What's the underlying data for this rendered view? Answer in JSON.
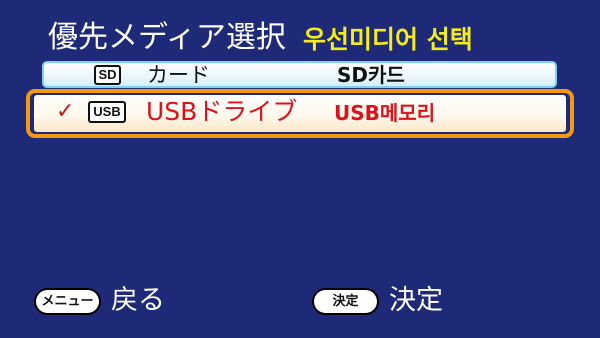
{
  "header": {
    "title_jp": "優先メディア選択",
    "title_ko": "우선미디어 선택"
  },
  "items": [
    {
      "icon": "SD",
      "label_jp": "カード",
      "label_ko": "SD카드",
      "selected": false
    },
    {
      "icon": "USB",
      "label_jp": "USBドライブ",
      "label_ko": "USB메모리",
      "selected": true,
      "check": "✓"
    }
  ],
  "footer": {
    "menu_button": "メニュー",
    "menu_label": "戻る",
    "ok_button": "決定",
    "ok_label": "決定"
  },
  "colors": {
    "background": "#1e2a78",
    "title_ko": "#f4ec1c",
    "selection_frame": "#f39a14",
    "selected_text": "#d8141c",
    "sd_border": "#7fd3f0"
  }
}
